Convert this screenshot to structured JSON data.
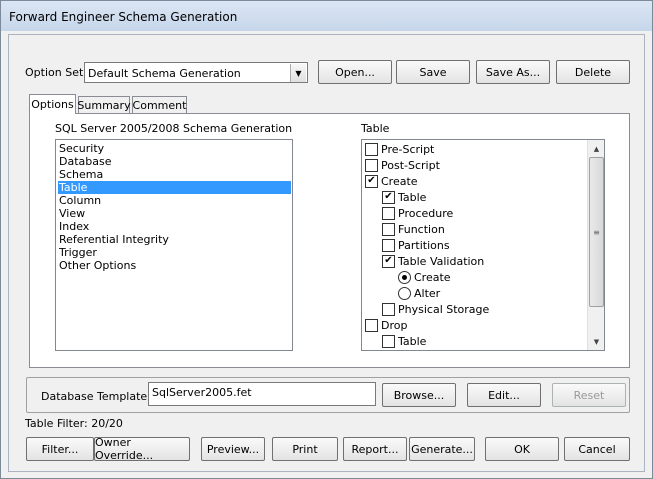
{
  "window": {
    "title": "Forward Engineer Schema Generation"
  },
  "option_set": {
    "label": "Option Set:",
    "value": "Default Schema Generation",
    "buttons": {
      "open": "Open...",
      "save": "Save",
      "save_as": "Save As...",
      "delete": "Delete"
    }
  },
  "tabs": [
    {
      "label": "Options",
      "active": true
    },
    {
      "label": "Summary",
      "active": false
    },
    {
      "label": "Comment",
      "active": false
    }
  ],
  "left_list": {
    "heading": "SQL Server 2005/2008 Schema Generation",
    "items": [
      "Security",
      "Database",
      "Schema",
      "Table",
      "Column",
      "View",
      "Index",
      "Referential Integrity",
      "Trigger",
      "Other Options"
    ],
    "selected": "Table"
  },
  "right_tree": {
    "heading": "Table",
    "items": [
      {
        "label": "Pre-Script",
        "type": "checkbox",
        "checked": false,
        "indent": 0
      },
      {
        "label": "Post-Script",
        "type": "checkbox",
        "checked": false,
        "indent": 0
      },
      {
        "label": "Create",
        "type": "checkbox",
        "checked": true,
        "indent": 0
      },
      {
        "label": "Table",
        "type": "checkbox",
        "checked": true,
        "indent": 1
      },
      {
        "label": "Procedure",
        "type": "checkbox",
        "checked": false,
        "indent": 1
      },
      {
        "label": "Function",
        "type": "checkbox",
        "checked": false,
        "indent": 1
      },
      {
        "label": "Partitions",
        "type": "checkbox",
        "checked": false,
        "indent": 1
      },
      {
        "label": "Table Validation",
        "type": "checkbox",
        "checked": true,
        "indent": 1
      },
      {
        "label": "Create",
        "type": "radio",
        "checked": true,
        "indent": 2
      },
      {
        "label": "Alter",
        "type": "radio",
        "checked": false,
        "indent": 2
      },
      {
        "label": "Physical Storage",
        "type": "checkbox",
        "checked": false,
        "indent": 1
      },
      {
        "label": "Drop",
        "type": "checkbox",
        "checked": false,
        "indent": 0
      },
      {
        "label": "Table",
        "type": "checkbox",
        "checked": false,
        "indent": 1
      }
    ]
  },
  "database_template": {
    "label": "Database Template:",
    "value": "SqlServer2005.fet",
    "buttons": {
      "browse": "Browse...",
      "edit": "Edit...",
      "reset": "Reset"
    }
  },
  "table_filter": "Table Filter: 20/20",
  "bottom_buttons": {
    "filter": "Filter...",
    "owner_override": "Owner Override...",
    "preview": "Preview...",
    "print": "Print",
    "report": "Report...",
    "generate": "Generate...",
    "ok": "OK",
    "cancel": "Cancel"
  }
}
